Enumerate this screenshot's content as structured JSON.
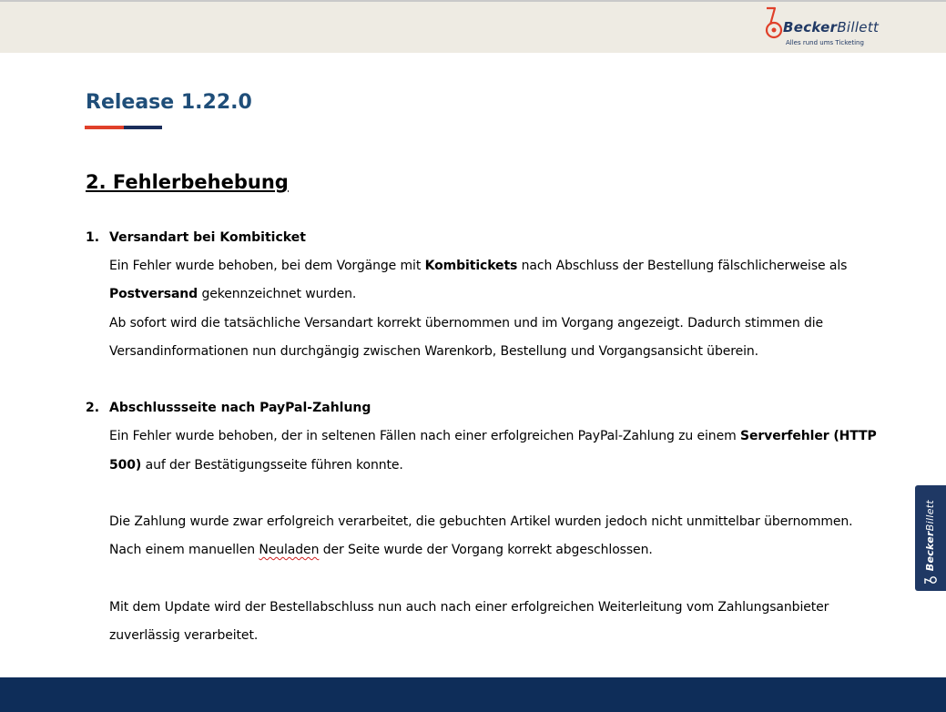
{
  "header": {
    "brand_bold": "Becker",
    "brand_light": "Billett",
    "tagline": "Alles rund ums Ticketing"
  },
  "release": {
    "title": "Release 1.22.0"
  },
  "section": {
    "heading": "2. Fehlerbehebung"
  },
  "items": [
    {
      "number": "1.",
      "title": "Versandart bei Kombiticket",
      "lines": [
        [
          "Ein Fehler wurde behoben, bei dem Vorgänge mit ",
          "Kombitickets",
          " nach Abschluss der Bestellung fälschlicherweise als"
        ],
        [
          "",
          "Postversand",
          " gekennzeichnet wurden."
        ],
        [
          "Ab sofort wird die tatsächliche Versandart korrekt übernommen und im Vorgang angezeigt. Dadurch stimmen die"
        ],
        [
          "Versandinformationen nun durchgängig zwischen Warenkorb, Bestellung und Vorgangsansicht überein."
        ]
      ]
    },
    {
      "number": "2.",
      "title": "Abschlussseite nach PayPal-Zahlung",
      "lines": [
        [
          "Ein Fehler wurde behoben, der in seltenen Fällen nach einer erfolgreichen PayPal-Zahlung zu einem ",
          "Serverfehler (HTTP"
        ],
        [
          "",
          "500)",
          " auf der Bestätigungsseite führen konnte."
        ],
        [
          "Die Zahlung wurde zwar erfolgreich verarbeitet, die gebuchten Artikel wurden jedoch nicht unmittelbar übernommen."
        ],
        [
          "Nach einem manuellen ",
          "Neuladen",
          " der Seite wurde der Vorgang korrekt abgeschlossen."
        ],
        [
          "Mit dem Update wird der Bestellabschluss nun auch nach einer erfolgreichen Weiterleitung vom Zahlungsanbieter"
        ],
        [
          "zuverlässig verarbeitet."
        ]
      ]
    }
  ],
  "side_tab": {
    "brand_bold": "Becker",
    "brand_light": "Billett"
  },
  "colors": {
    "accent_red": "#e0402a",
    "navy": "#1a2d5a",
    "title_blue": "#1f4e79",
    "header_bg": "#eeebe3",
    "footer": "#0e2d59"
  }
}
